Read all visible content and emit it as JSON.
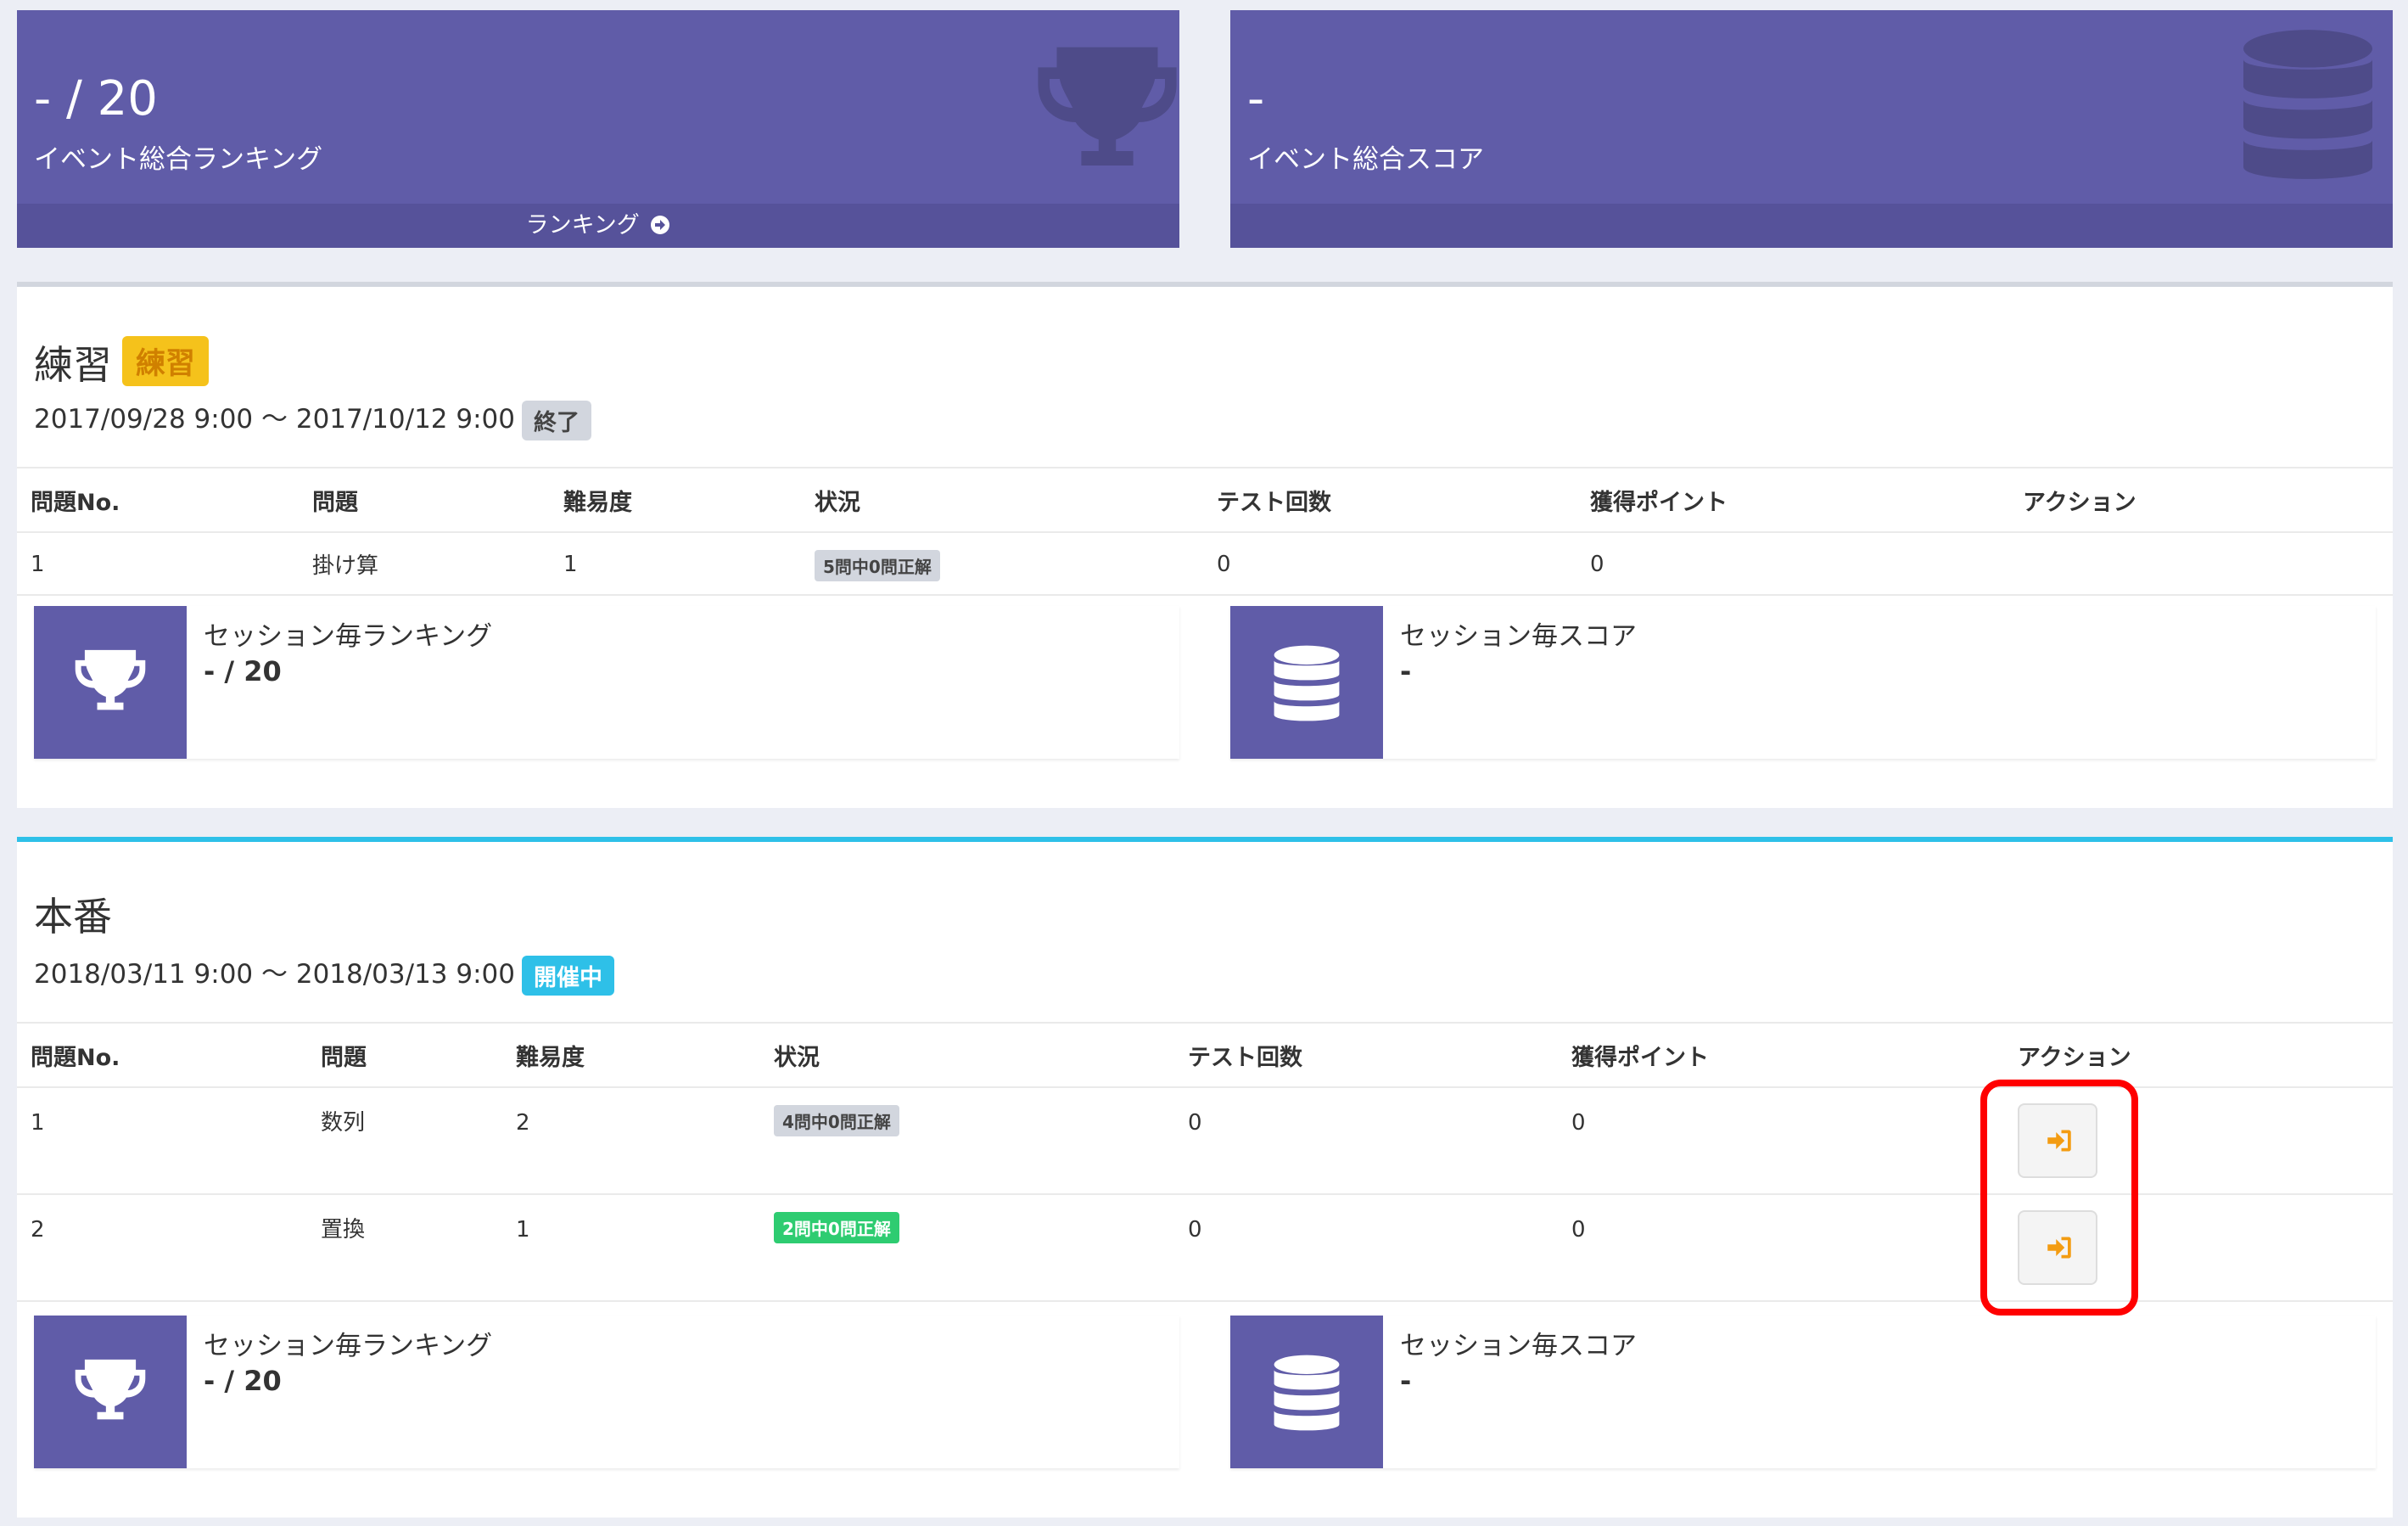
{
  "summary": {
    "ranking": {
      "value": "- / 20",
      "label": "イベント総合ランキング",
      "footer_link": "ランキング"
    },
    "score": {
      "value": "-",
      "label": "イベント総合スコア"
    }
  },
  "table_headers": [
    "問題No.",
    "問題",
    "難易度",
    "状況",
    "テスト回数",
    "獲得ポイント",
    "アクション"
  ],
  "sessions": [
    {
      "title": "練習",
      "title_badge": "練習",
      "period": "2017/09/28 9:00 〜 2017/10/12 9:00",
      "status": "終了",
      "rows": [
        {
          "no": "1",
          "problem": "掛け算",
          "difficulty": "1",
          "status": "5問中0問正解",
          "tests": "0",
          "points": "0"
        }
      ],
      "ranking_label": "セッション毎ランキング",
      "ranking_value": "- /  20",
      "score_label": "セッション毎スコア",
      "score_value": "-"
    },
    {
      "title": "本番",
      "period": "2018/03/11 9:00 〜 2018/03/13 9:00",
      "status": "開催中",
      "rows": [
        {
          "no": "1",
          "problem": "数列",
          "difficulty": "2",
          "status": "4問中0問正解",
          "tests": "0",
          "points": "0"
        },
        {
          "no": "2",
          "problem": "置換",
          "difficulty": "1",
          "status": "2問中0問正解",
          "tests": "0",
          "points": "0"
        }
      ],
      "ranking_label": "セッション毎ランキング",
      "ranking_value": "- /  20",
      "score_label": "セッション毎スコア",
      "score_value": "-"
    }
  ],
  "colors": {
    "primary": "#605ca8",
    "practice_badge": "#f5c21b",
    "open_badge": "#2ec0e8",
    "end_badge": "#d2d6de",
    "correct_badge": "#2ecc71",
    "action_icon": "#f39c12",
    "highlight": "#ff0000"
  },
  "icons": [
    "trophy-icon",
    "database-icon",
    "arrow-circle-right-icon",
    "sign-in-icon"
  ]
}
